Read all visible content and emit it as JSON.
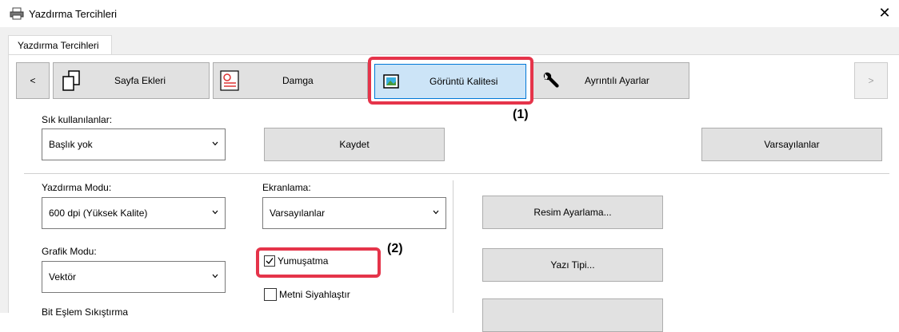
{
  "window": {
    "title": "Yazdırma Tercihleri",
    "close_glyph": "✕"
  },
  "tab": {
    "label": "Yazdırma Tercihleri"
  },
  "toolbar": {
    "prev_label": "<",
    "next_label": ">",
    "items": [
      {
        "label": "Sayfa Ekleri",
        "icon": "pages-icon"
      },
      {
        "label": "Damga",
        "icon": "stamp-icon"
      },
      {
        "label": "Görüntü Kalitesi",
        "icon": "image-icon",
        "selected": true
      },
      {
        "label": "Ayrıntılı Ayarlar",
        "icon": "wrench-icon"
      }
    ]
  },
  "favorites": {
    "label": "Sık kullanılanlar:",
    "value": "Başlık yok",
    "save_label": "Kaydet",
    "defaults_label": "Varsayılanlar"
  },
  "print_mode": {
    "label": "Yazdırma Modu:",
    "value": "600 dpi (Yüksek Kalite)"
  },
  "screening": {
    "label": "Ekranlama:",
    "value": "Varsayılanlar"
  },
  "graphic_mode": {
    "label": "Grafik Modu:",
    "value": "Vektör"
  },
  "options": {
    "smoothing": {
      "label": "Yumuşatma",
      "checked": true
    },
    "black_text": {
      "label": "Metni Siyahlaştır",
      "checked": false
    }
  },
  "right_buttons": {
    "image_adjust": "Resim Ayarlama...",
    "font": "Yazı Tipi..."
  },
  "partial_label": "Bit Eşlem Sıkıştırma",
  "callouts": {
    "one": "(1)",
    "two": "(2)"
  },
  "colors": {
    "highlight": "#e5344a",
    "selected_bg": "#cce4f7",
    "selected_border": "#0078d7"
  }
}
